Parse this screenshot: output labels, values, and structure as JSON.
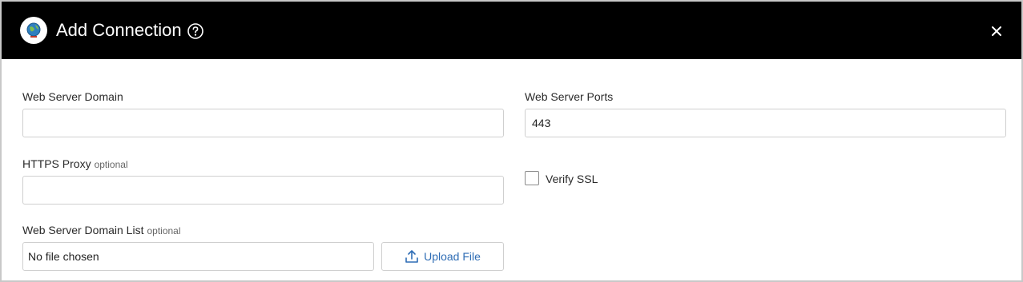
{
  "dialog": {
    "title": "Add Connection",
    "icons": {
      "logo": "globe-logo-icon",
      "help": "question-circle-icon",
      "close": "close-icon"
    }
  },
  "form": {
    "web_server_domain": {
      "label": "Web Server Domain",
      "value": "",
      "placeholder": ""
    },
    "web_server_ports": {
      "label": "Web Server Ports",
      "value": "443"
    },
    "https_proxy": {
      "label": "HTTPS Proxy",
      "optional": "optional",
      "value": ""
    },
    "verify_ssl": {
      "label": "Verify SSL",
      "checked": false
    },
    "domain_list": {
      "label": "Web Server Domain List",
      "optional": "optional",
      "file_status": "No file chosen",
      "upload_label": "Upload File",
      "upload_icon": "upload-icon"
    }
  },
  "colors": {
    "header_bg": "#000000",
    "accent": "#2f6db5",
    "border": "#cfcfcf"
  }
}
